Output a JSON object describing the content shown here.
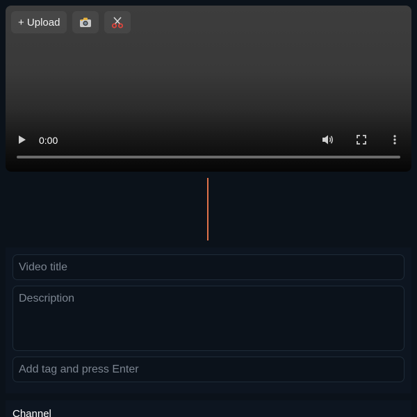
{
  "toolbar": {
    "upload_label": "+ Upload",
    "camera_icon": "camera-icon",
    "cut_icon": "scissors-icon"
  },
  "player": {
    "current_time": "0:00",
    "progress": 0,
    "icons": [
      "play-icon",
      "volume-icon",
      "fullscreen-icon",
      "more-vert-icon"
    ]
  },
  "colors": {
    "divider": "#e2734a",
    "background": "#0b121a"
  },
  "form": {
    "title_placeholder": "Video title",
    "title_value": "",
    "description_placeholder": "Description",
    "description_value": "",
    "tag_placeholder": "Add tag and press Enter",
    "tag_value": ""
  },
  "channel": {
    "label": "Channel"
  }
}
